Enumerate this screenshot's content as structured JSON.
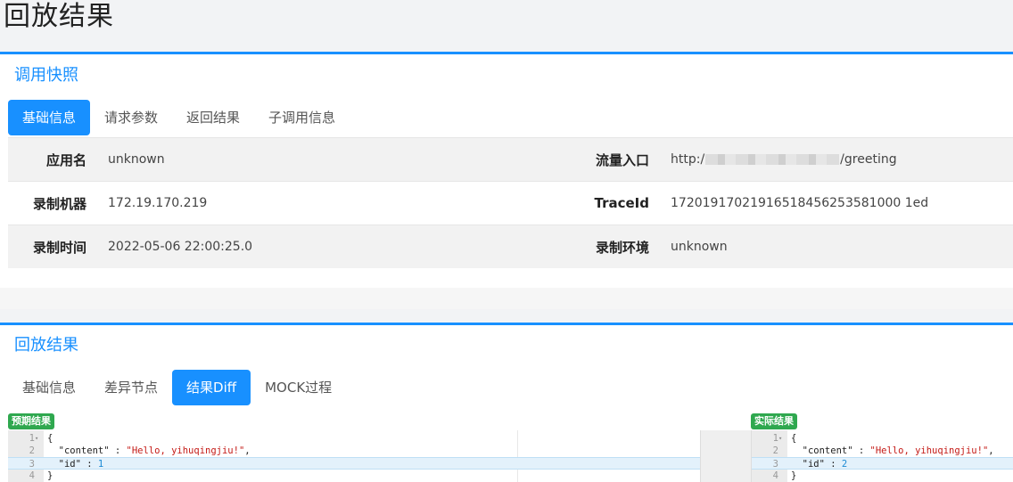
{
  "page": {
    "title": "回放结果"
  },
  "snapshot": {
    "title": "调用快照",
    "tabs": [
      "基础信息",
      "请求参数",
      "返回结果",
      "子调用信息"
    ],
    "rows": [
      {
        "left_label": "应用名",
        "left_value": "unknown",
        "right_label": "流量入口",
        "right_value_prefix": "http:/",
        "right_value_suffix": "/greeting"
      },
      {
        "left_label": "录制机器",
        "left_value": "172.19.170.219",
        "right_label": "TraceId",
        "right_value": "17201917021916518456253581000 1ed"
      },
      {
        "left_label": "录制时间",
        "left_value": "2022-05-06 22:00:25.0",
        "right_label": "录制环境",
        "right_value": "unknown"
      }
    ]
  },
  "replay": {
    "title": "回放结果",
    "tabs": [
      "基础信息",
      "差异节点",
      "结果Diff",
      "MOCK过程"
    ],
    "expected_badge": "预期结果",
    "actual_badge": "实际结果",
    "expected_lines": [
      {
        "n": "1",
        "fold": "▾",
        "code": "{"
      },
      {
        "n": "2",
        "code": "  \"content\" : ",
        "str": "\"Hello, yihuqingjiu!\"",
        "tail": ","
      },
      {
        "n": "3",
        "code": "  \"id\" : ",
        "num": "1",
        "highlight": true
      },
      {
        "n": "4",
        "code": "}"
      }
    ],
    "actual_lines": [
      {
        "n": "1",
        "fold": "▾",
        "code": "{"
      },
      {
        "n": "2",
        "code": "  \"content\" : ",
        "str": "\"Hello, yihuqingjiu!\"",
        "tail": ","
      },
      {
        "n": "3",
        "code": "  \"id\" : ",
        "num": "2",
        "highlight": true
      },
      {
        "n": "4",
        "code": "}"
      }
    ]
  }
}
